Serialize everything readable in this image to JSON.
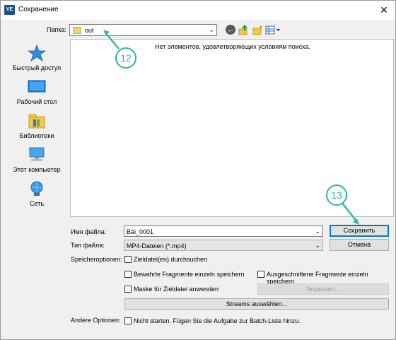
{
  "window": {
    "icon_text": "VE",
    "title": "Сохранение",
    "close_glyph": "✕"
  },
  "toolbar": {
    "lookin_label": "Папка:",
    "lookin_value": "out"
  },
  "places": [
    {
      "label": "Быстрый доступ",
      "icon": "star-icon"
    },
    {
      "label": "Рабочий стол",
      "icon": "desktop-icon"
    },
    {
      "label": "Библиотеки",
      "icon": "library-icon"
    },
    {
      "label": "Этот компьютер",
      "icon": "computer-icon"
    },
    {
      "label": "Сеть",
      "icon": "network-icon"
    }
  ],
  "filelist": {
    "empty_message": "Нет элементов, удовлетворяющих условиям поиска."
  },
  "form": {
    "filename_label": "Имя файла:",
    "filename_value": "Bài_0001",
    "filetype_label": "Тип файла:",
    "filetype_value": "MP4-Dateien (*.mp4)",
    "save_button": "Сохранить",
    "cancel_button": "Отмена"
  },
  "options": {
    "storage_label": "Speicheroptionen:",
    "search_targets": "Zieldatei(en) durchsuchen",
    "keep_fragments": "Bewahrte Fragmente einzeln speichern",
    "cut_fragments": "Ausgeschnittene Fragmente einzeln speichern",
    "mask": "Maske für Zieldatei anwenden",
    "customize_button": "Anpassen...",
    "streams_button": "Streams auswählen...",
    "other_label": "Andere Optionen:",
    "no_start": "Nicht starten. Fügen Sie die Aufgabe zur Batch-Liste hinzu."
  },
  "annotations": {
    "callout_12": "12",
    "callout_13": "13",
    "color": "#2db8a0"
  }
}
